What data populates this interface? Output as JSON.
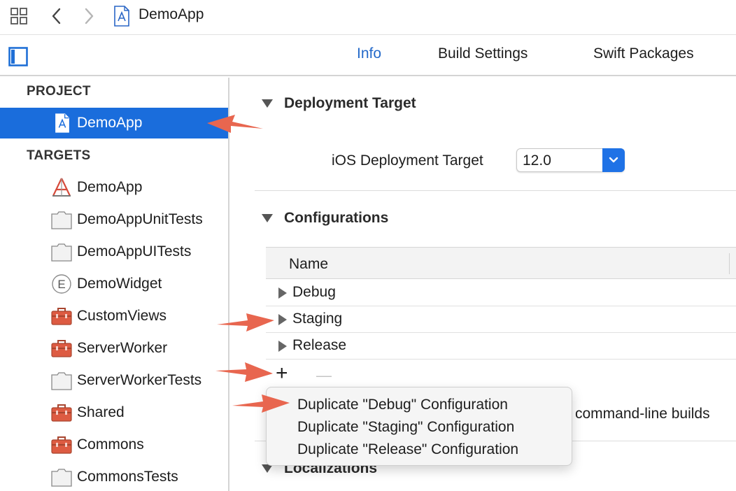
{
  "titlebar": {
    "icons": [
      "grid-icon",
      "back-chevron-icon",
      "forward-chevron-icon",
      "project-file-icon"
    ],
    "title": "DemoApp"
  },
  "tabbar": {
    "tabs": [
      {
        "label": "Info",
        "active": true
      },
      {
        "label": "Build Settings",
        "active": false
      },
      {
        "label": "Swift Packages",
        "active": false
      }
    ]
  },
  "sidebar": {
    "project_header": "PROJECT",
    "project_item": {
      "label": "DemoApp",
      "icon": "project-file-icon"
    },
    "targets_header": "TARGETS",
    "targets": [
      {
        "label": "DemoApp",
        "icon": "app-target-icon"
      },
      {
        "label": "DemoAppUnitTests",
        "icon": "test-bundle-icon"
      },
      {
        "label": "DemoAppUITests",
        "icon": "test-bundle-icon"
      },
      {
        "label": "DemoWidget",
        "icon": "extension-icon"
      },
      {
        "label": "CustomViews",
        "icon": "framework-toolbox-icon"
      },
      {
        "label": "ServerWorker",
        "icon": "framework-toolbox-icon"
      },
      {
        "label": "ServerWorkerTests",
        "icon": "test-bundle-icon"
      },
      {
        "label": "Shared",
        "icon": "framework-toolbox-icon"
      },
      {
        "label": "Commons",
        "icon": "framework-toolbox-icon"
      },
      {
        "label": "CommonsTests",
        "icon": "test-bundle-icon"
      }
    ]
  },
  "main": {
    "deployment": {
      "title": "Deployment Target",
      "field_label": "iOS Deployment Target",
      "value": "12.0"
    },
    "configurations": {
      "title": "Configurations",
      "column_header": "Name",
      "rows": [
        "Debug",
        "Staging",
        "Release"
      ],
      "add_symbol": "+",
      "remove_symbol": "—",
      "partial_text": "command-line builds"
    },
    "localizations": {
      "title": "Localizations"
    }
  },
  "dropdown": {
    "items": [
      "Duplicate \"Debug\" Configuration",
      "Duplicate \"Staging\" Configuration",
      "Duplicate \"Release\" Configuration"
    ]
  },
  "colors": {
    "accent": "#1a6ddc",
    "tab_active": "#2369c9",
    "annotation_arrow": "#e8664f"
  }
}
